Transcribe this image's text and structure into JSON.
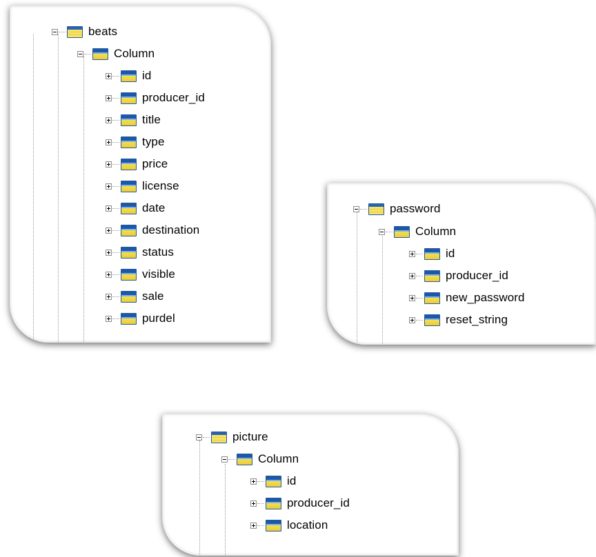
{
  "trees": [
    {
      "table": "beats",
      "group": "Column",
      "columns": [
        "id",
        "producer_id",
        "title",
        "type",
        "price",
        "license",
        "date",
        "destination",
        "status",
        "visible",
        "sale",
        "purdel"
      ]
    },
    {
      "table": "password",
      "group": "Column",
      "columns": [
        "id",
        "producer_id",
        "new_password",
        "reset_string"
      ]
    },
    {
      "table": "picture",
      "group": "Column",
      "columns": [
        "id",
        "producer_id",
        "location"
      ]
    }
  ],
  "icons": {
    "table": "table-icon",
    "column_group": "column-group-icon",
    "column": "column-icon",
    "expand": "plus-icon",
    "collapse": "minus-icon"
  }
}
